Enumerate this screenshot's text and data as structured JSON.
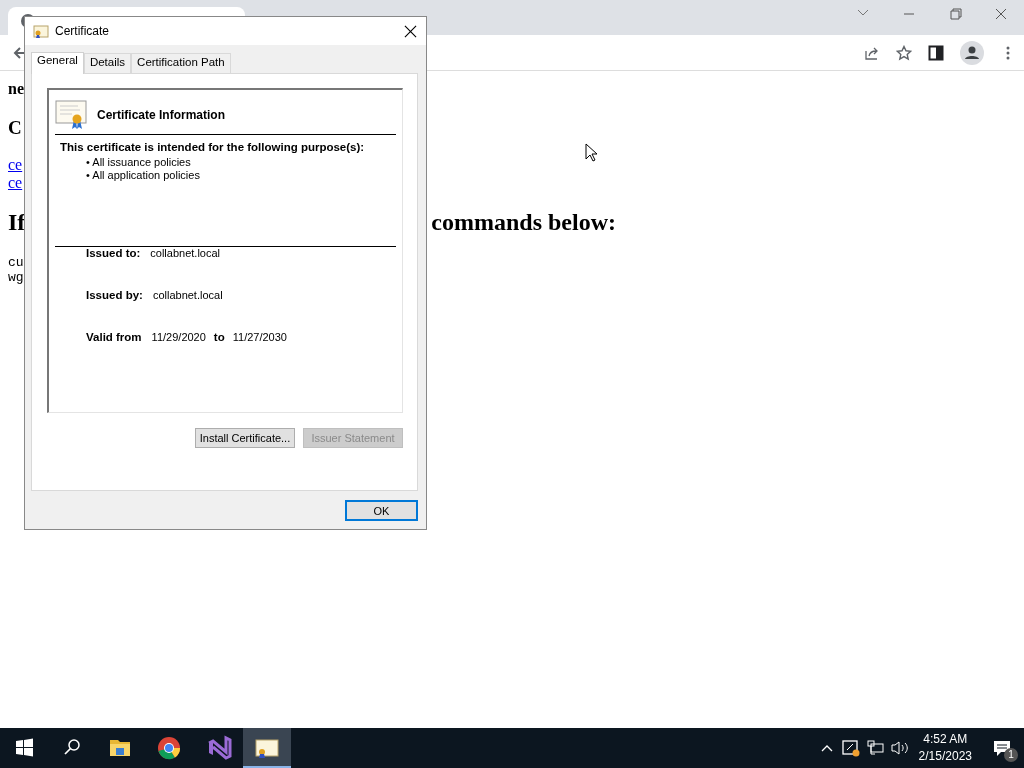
{
  "browser": {
    "tab": {
      "kind": "page"
    }
  },
  "page": {
    "lines": [
      {
        "kind": "bold",
        "text": "ne"
      },
      {
        "kind": "h3",
        "text": "C"
      },
      {
        "kind": "link",
        "text": "ce"
      },
      {
        "kind": "link",
        "text": "ce"
      },
      {
        "kind": "h2",
        "text": "If",
        "rest": "commands below:"
      },
      {
        "kind": "code",
        "text": "cu"
      },
      {
        "kind": "code",
        "text": "wg"
      }
    ]
  },
  "dialog": {
    "title": "Certificate",
    "tabs": [
      {
        "label": "General",
        "selected": true
      },
      {
        "label": "Details",
        "selected": false
      },
      {
        "label": "Certification Path",
        "selected": false
      }
    ],
    "info_title": "Certificate Information",
    "purpose_heading": "This certificate is intended for the following purpose(s):",
    "purposes": [
      "• All issuance policies",
      "• All application policies"
    ],
    "issued_to": {
      "label": "Issued to:",
      "value": "collabnet.local"
    },
    "issued_by": {
      "label": "Issued by:",
      "value": "collabnet.local"
    },
    "validity": {
      "label": "Valid from",
      "from": "11/29/2020",
      "to_label": "to",
      "to": "11/27/2030"
    },
    "buttons": [
      {
        "label": "Install Certificate...",
        "disabled": false
      },
      {
        "label": "Issuer Statement",
        "disabled": true
      }
    ],
    "ok": {
      "label": "OK"
    }
  },
  "taskbar": {
    "apps": [
      {
        "kind": "folder",
        "active": false
      },
      {
        "kind": "chrome",
        "active": false
      },
      {
        "kind": "studio",
        "active": false
      },
      {
        "kind": "certificate",
        "active": true
      }
    ],
    "time": "4:52 AM",
    "date": "2/15/2023",
    "notifications": "1"
  }
}
